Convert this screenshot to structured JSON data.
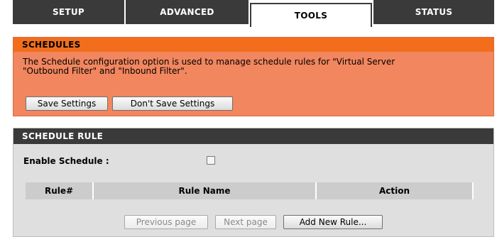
{
  "tabs": [
    {
      "label": "SETUP",
      "active": false
    },
    {
      "label": "ADVANCED",
      "active": false
    },
    {
      "label": "TOOLS",
      "active": true
    },
    {
      "label": "STATUS",
      "active": false
    }
  ],
  "schedules": {
    "header": "SCHEDULES",
    "line1": "The Schedule configuration option is used to manage schedule rules for \"Virtual Server",
    "line2": "\"Outbound Filter\" and \"Inbound Filter\".",
    "save_label": "Save Settings",
    "dont_save_label": "Don't Save Settings"
  },
  "schedule_rule": {
    "header": "SCHEDULE RULE",
    "enable_label": "Enable Schedule :",
    "enable_checked": false,
    "columns": [
      "Rule#",
      "Rule Name",
      "Action"
    ],
    "prev_label": "Previous page",
    "next_label": "Next page",
    "add_label": "Add New Rule..."
  },
  "colors": {
    "tab_bg": "#3a3a3a",
    "orange_header": "#f26e1d",
    "orange_body": "#f1865f"
  }
}
